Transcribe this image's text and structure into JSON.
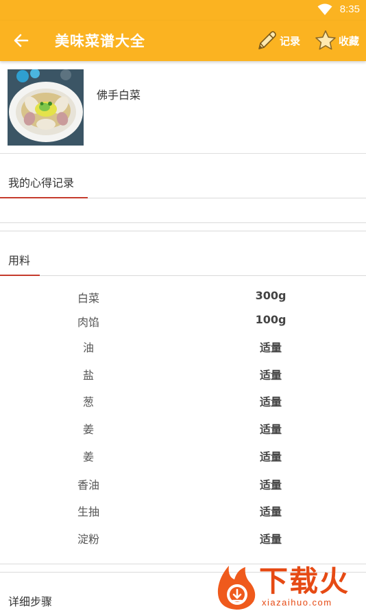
{
  "status_bar": {
    "time": "8:35",
    "wifi_icon": "wifi-icon"
  },
  "app_bar": {
    "title": "美味菜谱大全",
    "back_icon": "arrow-back-icon",
    "actions": [
      {
        "label": "记录",
        "icon": "pencil-icon"
      },
      {
        "label": "收藏",
        "icon": "star-icon"
      }
    ],
    "color": "#fbb321"
  },
  "dish": {
    "name": "佛手白菜"
  },
  "notes_tab": {
    "label": "我的心得记录",
    "accent": "#c53a2c"
  },
  "ingredients_tab": {
    "label": "用料"
  },
  "ingredients": [
    {
      "name": "白菜",
      "amount": "300g"
    },
    {
      "name": "肉馅",
      "amount": "100g"
    },
    {
      "name": "油",
      "amount": "适量"
    },
    {
      "name": "盐",
      "amount": "适量"
    },
    {
      "name": "葱",
      "amount": "适量"
    },
    {
      "name": "姜",
      "amount": "适量"
    },
    {
      "name": "姜",
      "amount": "适量"
    },
    {
      "name": "香油",
      "amount": "适量"
    },
    {
      "name": "生抽",
      "amount": "适量"
    },
    {
      "name": "淀粉",
      "amount": "适量"
    }
  ],
  "steps_tab": {
    "label": "详细步骤"
  },
  "watermark": {
    "text": "下载火",
    "url": "xiazaihuo.com"
  }
}
